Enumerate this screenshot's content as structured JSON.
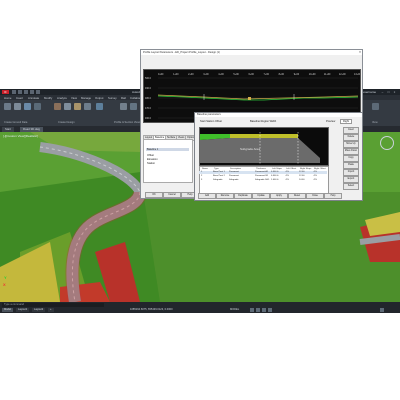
{
  "app": {
    "logo": "C",
    "title": "Autodesk Civil 3D 2023 - [C3D PROJECT.dwg] - Road Building",
    "user": "username",
    "window_controls": [
      "–",
      "□",
      "×"
    ]
  },
  "menu": [
    "Home",
    "Insert",
    "Annotate",
    "Modify",
    "Analyze",
    "View",
    "Manage",
    "Output",
    "Survey",
    "Rail",
    "Collaborate",
    "Help",
    "Add-ins",
    "Express Tools",
    "Featured Apps"
  ],
  "ribbon": {
    "panels": [
      "Create Ground Data",
      "Create Design",
      "Profile & Section Views",
      "Draw",
      "Modify",
      "Layers",
      "Clipboard",
      "Properties",
      "Groups",
      "Utilities",
      "View"
    ]
  },
  "doc_tabs": [
    "Start",
    "Road 3D.dwg"
  ],
  "viewport": {
    "label": "[-][Custom View][Realistic]",
    "axis_x": "X",
    "axis_y": "Y"
  },
  "status": {
    "command_placeholder": "Type a command",
    "layout_tabs": [
      "Model",
      "Layout1",
      "Layout2",
      "+"
    ],
    "coords": "1085164.6075, 655439.0123, 0.0000",
    "model_label": "MODEL"
  },
  "profile_dialog": {
    "title": "Profile Layout Parameters - ED_Project Profile_Layout - Design (1)",
    "close": "×",
    "toolbar_labels": [
      "Profile tool",
      "Edit layout",
      "Reset"
    ],
    "toolbar_right_label": "Preferences Panel",
    "station_labels": [
      "0+00",
      "1+00",
      "2+00",
      "3+00",
      "4+00",
      "5+00",
      "6+00",
      "7+00",
      "8+00",
      "9+00",
      "10+00",
      "11+00",
      "12+00",
      "13+00"
    ],
    "elevation_labels": [
      "500.0",
      "490.0",
      "480.0",
      "470.0",
      "460.0"
    ],
    "tabs": [
      "Layout",
      "Baseline",
      "Surface",
      "Views",
      "Options"
    ],
    "left_item": "Baseline 1",
    "left_values": [
      "Offset",
      "Elevation",
      "Station"
    ],
    "bottom_buttons": [
      "OK",
      "Cancel",
      "Help"
    ]
  },
  "baseline_dialog": {
    "title": "Baseline parameters",
    "header_labels": [
      "Start Station Offset",
      "Baseline Region Width",
      "Preview"
    ],
    "preview_value": "Right",
    "region_label": "Subgrade Area",
    "grid_headers": [
      "Name",
      "Type",
      "Description",
      "Thickness",
      "Left Slope",
      "Left Offset",
      "Right Slope",
      "Right Offset"
    ],
    "grid_rows": [
      [
        "1",
        "Base Pavt 1",
        "Pavement",
        "Pavement A1",
        "0.500 ft",
        "-2%",
        "12.00",
        "-2%"
      ],
      [
        "2",
        "Base Pavt 2",
        "Pavement",
        "Pavement B1",
        "0.500 ft",
        "-2%",
        "12.00",
        "-2%"
      ],
      [
        "3",
        "Subgrade",
        "Subgrade",
        "Subgrade SG1",
        "1.000 ft",
        "-2%",
        "14.00",
        "-2%"
      ]
    ],
    "side_buttons": [
      "Insert",
      "Delete",
      "Move Up",
      "Move Down",
      "Copy",
      "Paste",
      "Import",
      "Export",
      "Select"
    ],
    "bottom_buttons": [
      "Add",
      "Remove",
      "Duplicate",
      "Update",
      "Apply",
      "Reset",
      "Close",
      "Help"
    ]
  },
  "colors": {
    "graph_bg": "#0d0d0d",
    "profile_line": "#c6a94a",
    "ground_line": "#2cc83a",
    "accent_red": "#c8202a"
  }
}
